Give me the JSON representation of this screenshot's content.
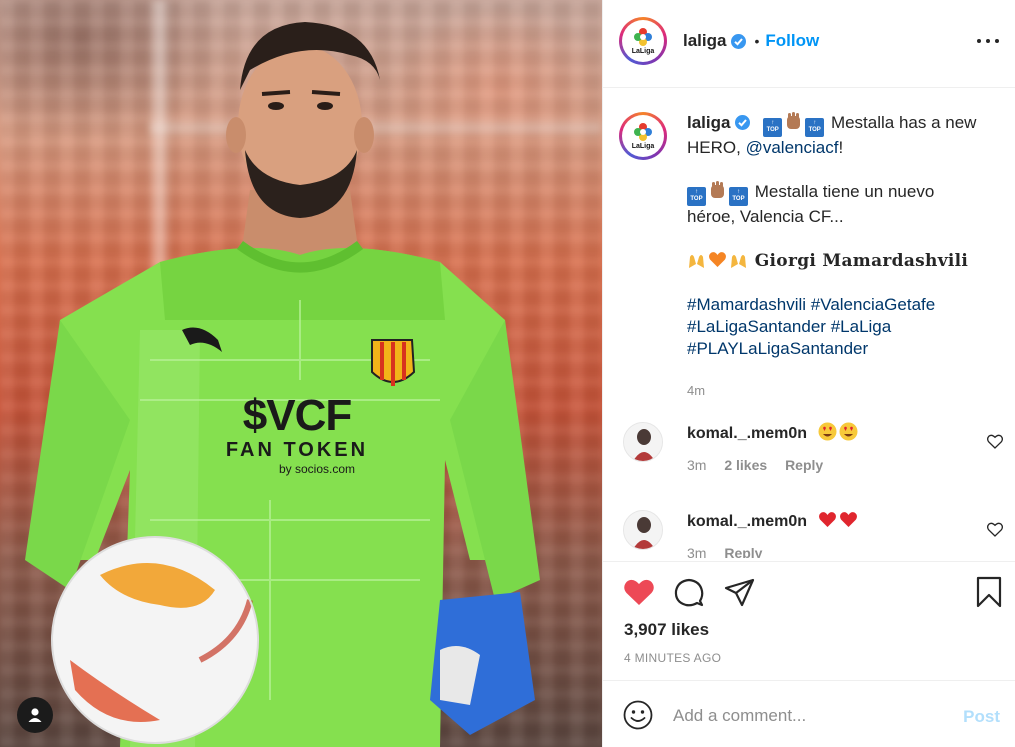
{
  "post": {
    "username": "laliga",
    "follow_label": "Follow",
    "logo_text": "LaLiga",
    "caption": {
      "line1": "Mestalla has a new",
      "line1b": "HERO,",
      "mention": "@valenciacf",
      "excl": "!",
      "line2": "Mestalla tiene un nuevo",
      "line2b": "héroe, Valencia CF...",
      "player_name": "Giorgi Mamardashvili",
      "hashtags": [
        "#Mamardashvili",
        "#ValenciaGetafe",
        "#LaLigaSantander",
        "#LaLiga",
        "#PLAYLaLigaSantander"
      ],
      "age": "4m"
    },
    "photo": {
      "jersey_brand": "$VCF",
      "jersey_line2": "FAN TOKEN",
      "jersey_line3": "by socios.com"
    }
  },
  "comments": [
    {
      "username": "komal._.mem0n",
      "emojis": "heart-eyes",
      "age": "3m",
      "likes": "2 likes",
      "reply": "Reply"
    },
    {
      "username": "komal._.mem0n",
      "emojis": "red-hearts",
      "age": "3m",
      "likes": "",
      "reply": "Reply"
    }
  ],
  "stats": {
    "likes": "3,907 likes",
    "time_ago": "4 MINUTES AGO"
  },
  "composer": {
    "placeholder": "Add a comment...",
    "post_label": "Post"
  },
  "colors": {
    "link": "#0095f6",
    "hashtag": "#00376b",
    "like_red": "#ed4956",
    "jersey_green": "#7ed957"
  }
}
